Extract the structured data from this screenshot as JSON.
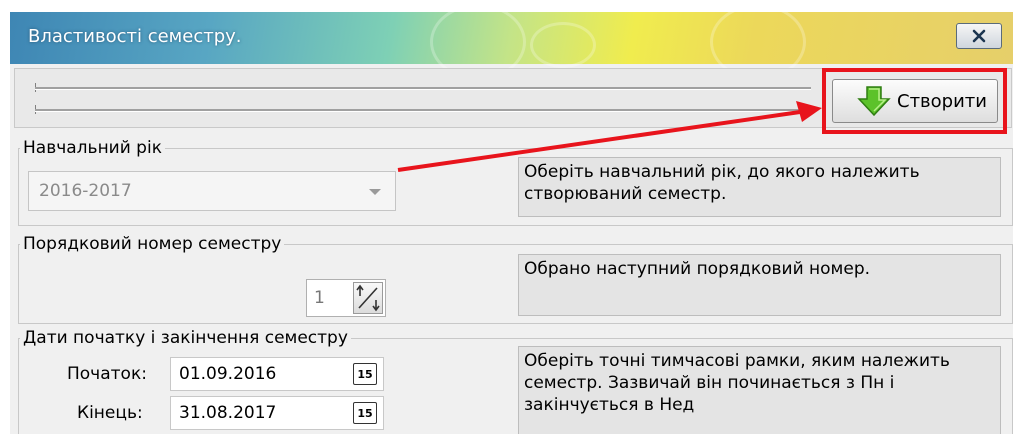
{
  "window": {
    "title": "Властивості семестру.",
    "close_label": "X"
  },
  "toolbar": {
    "create_label": "Створити"
  },
  "academic_year": {
    "legend": "Навчальний рік",
    "selected": "2016-2017",
    "hint": "Оберіть навчальний рік, до якого належить створюваний семестр."
  },
  "semester_number": {
    "legend": "Порядковий номер семестру",
    "value": "1",
    "hint": "Обрано наступний порядковий номер."
  },
  "dates": {
    "legend": "Дати початку  і закінчення семестру",
    "start_label": "Початок:",
    "start_value": "01.09.2016",
    "end_label": "Кінець:",
    "end_value": "31.08.2017",
    "calendar_icon_text": "15",
    "hint": "Оберіть точні тимчасові рамки, яким належить семестр. Зазвичай він починається з Пн і закінчується в Нед"
  },
  "colors": {
    "highlight": "#e8141c",
    "create_icon": "#4caf20"
  }
}
